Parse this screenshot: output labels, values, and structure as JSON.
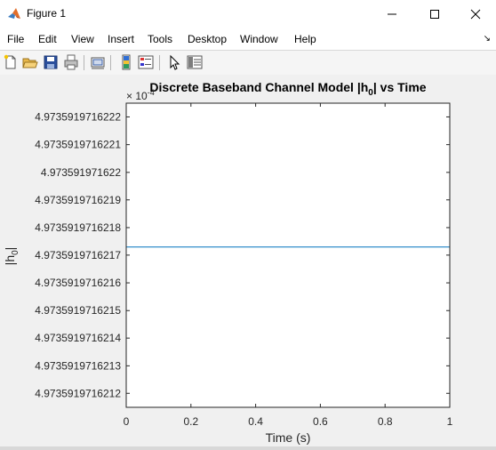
{
  "window": {
    "title": "Figure 1",
    "minimize_glyph": "—",
    "maximize_glyph": "☐",
    "close_glyph": "✕"
  },
  "menu": {
    "items": [
      "File",
      "Edit",
      "View",
      "Insert",
      "Tools",
      "Desktop",
      "Window",
      "Help"
    ],
    "dock_glyph": "↘"
  },
  "toolbar": {
    "icons": [
      "new-figure-icon",
      "open-file-icon",
      "save-icon",
      "print-icon",
      "link-plot-icon",
      "insert-colorbar-icon",
      "insert-legend-icon",
      "edit-plot-icon",
      "property-inspector-icon"
    ]
  },
  "chart_data": {
    "type": "line",
    "title": "Discrete Baseband Channel Model |h",
    "title_subscript": "0",
    "title_suffix": "| vs Time",
    "xlabel": "Time (s)",
    "ylabel": "|h",
    "ylabel_subscript": "0",
    "ylabel_suffix": "|",
    "y_exponent_base": "× 10",
    "y_exponent_power": "-4",
    "xlim": [
      0,
      1
    ],
    "ylim": [
      4.97359197162115,
      4.97359197162225
    ],
    "x_ticks": [
      0,
      0.2,
      0.4,
      0.6,
      0.8,
      1
    ],
    "x_tick_labels": [
      "0",
      "0.2",
      "0.4",
      "0.6",
      "0.8",
      "1"
    ],
    "y_ticks": [
      4.9735919716212,
      4.9735919716213,
      4.9735919716214,
      4.9735919716215,
      4.9735919716216,
      4.9735919716217,
      4.9735919716218,
      4.9735919716219,
      4.973591971622,
      4.9735919716221,
      4.9735919716222
    ],
    "y_tick_labels": [
      "4.9735919716212",
      "4.9735919716213",
      "4.9735919716214",
      "4.9735919716215",
      "4.9735919716216",
      "4.9735919716217",
      "4.9735919716218",
      "4.9735919716219",
      "4.973591971622",
      "4.9735919716221",
      "4.9735919716222"
    ],
    "series": [
      {
        "x": [
          0,
          1
        ],
        "values": [
          4.97359197162173,
          4.97359197162173
        ],
        "color": "#0072bd"
      }
    ],
    "grid": false
  }
}
